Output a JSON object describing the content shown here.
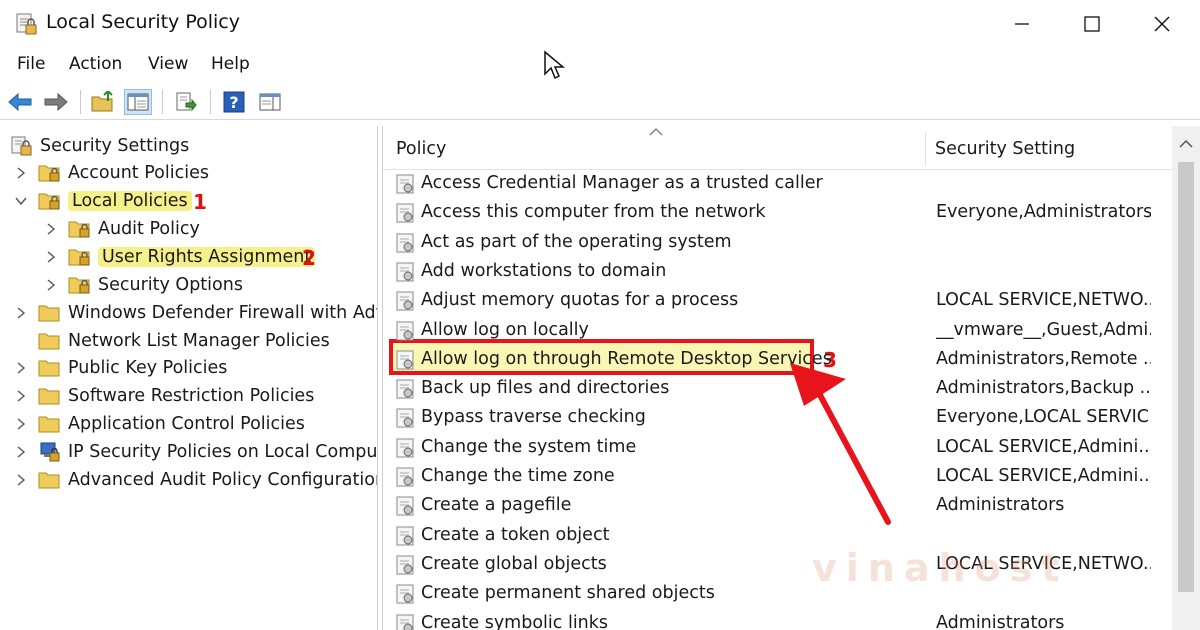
{
  "window": {
    "title": "Local Security Policy"
  },
  "menu": [
    "File",
    "Action",
    "View",
    "Help"
  ],
  "tree": [
    {
      "label": "Security Settings",
      "level": 0,
      "expanded": null,
      "highlight": false
    },
    {
      "label": "Account Policies",
      "level": 1,
      "expanded": false,
      "highlight": false
    },
    {
      "label": "Local Policies",
      "level": 1,
      "expanded": true,
      "highlight": true,
      "step": "1"
    },
    {
      "label": "Audit Policy",
      "level": 2,
      "expanded": false,
      "highlight": false
    },
    {
      "label": "User Rights Assignment",
      "level": 2,
      "expanded": false,
      "highlight": true,
      "step": "2"
    },
    {
      "label": "Security Options",
      "level": 2,
      "expanded": false,
      "highlight": false
    },
    {
      "label": "Windows Defender Firewall with Adva",
      "level": 1,
      "expanded": false,
      "highlight": false
    },
    {
      "label": "Network List Manager Policies",
      "level": 1,
      "expanded": null,
      "highlight": false
    },
    {
      "label": "Public Key Policies",
      "level": 1,
      "expanded": false,
      "highlight": false
    },
    {
      "label": "Software Restriction Policies",
      "level": 1,
      "expanded": false,
      "highlight": false
    },
    {
      "label": "Application Control Policies",
      "level": 1,
      "expanded": false,
      "highlight": false
    },
    {
      "label": "IP Security Policies on Local Compute",
      "level": 1,
      "expanded": false,
      "highlight": false,
      "icon": "ip-security-icon"
    },
    {
      "label": "Advanced Audit Policy Configuration",
      "level": 1,
      "expanded": false,
      "highlight": false
    }
  ],
  "columns": {
    "policy": "Policy",
    "setting": "Security Setting"
  },
  "policies": [
    {
      "name": "Access Credential Manager as a trusted caller",
      "setting": ""
    },
    {
      "name": "Access this computer from the network",
      "setting": "Everyone,Administrators..."
    },
    {
      "name": "Act as part of the operating system",
      "setting": ""
    },
    {
      "name": "Add workstations to domain",
      "setting": ""
    },
    {
      "name": "Adjust memory quotas for a process",
      "setting": "LOCAL SERVICE,NETWO..."
    },
    {
      "name": "Allow log on locally",
      "setting": "__vmware__,Guest,Admi..."
    },
    {
      "name": "Allow log on through Remote Desktop Services",
      "setting": "Administrators,Remote ..."
    },
    {
      "name": "Back up files and directories",
      "setting": "Administrators,Backup ..."
    },
    {
      "name": "Bypass traverse checking",
      "setting": "Everyone,LOCAL SERVIC..."
    },
    {
      "name": "Change the system time",
      "setting": "LOCAL SERVICE,Admini..."
    },
    {
      "name": "Change the time zone",
      "setting": "LOCAL SERVICE,Admini..."
    },
    {
      "name": "Create a pagefile",
      "setting": "Administrators"
    },
    {
      "name": "Create a token object",
      "setting": ""
    },
    {
      "name": "Create global objects",
      "setting": "LOCAL SERVICE,NETWO..."
    },
    {
      "name": "Create permanent shared objects",
      "setting": ""
    },
    {
      "name": "Create symbolic links",
      "setting": "Administrators"
    }
  ],
  "annotations": {
    "step3": "3"
  },
  "watermark": "vinahost",
  "colors": {
    "highlight": "#f5f08a",
    "annotation_red": "#e8141c",
    "selection": "#cfe3f7"
  }
}
